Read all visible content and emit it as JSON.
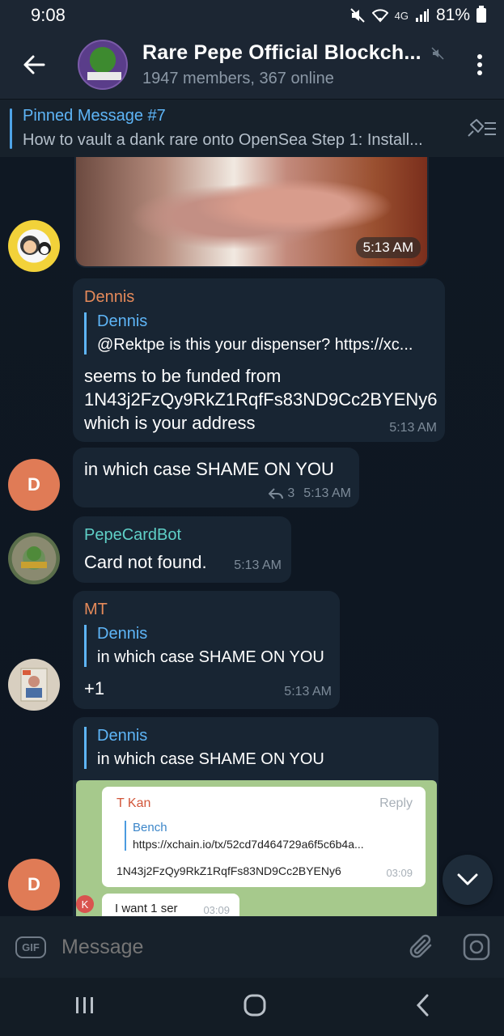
{
  "status_bar": {
    "time": "9:08",
    "network": "4G",
    "battery": "81%"
  },
  "header": {
    "title": "Rare Pepe Official Blockch...",
    "subtitle": "1947 members, 367 online"
  },
  "pinned": {
    "title": "Pinned Message #7",
    "text": "How to vault a dank rare onto OpenSea  Step 1: Install..."
  },
  "messages": [
    {
      "type": "image",
      "time": "5:13 AM"
    },
    {
      "sender": "Dennis",
      "sender_color": "#e58a5a",
      "reply_name": "Dennis",
      "reply_text": "@Rektpe is this your dispenser?  https://xc...",
      "text": "seems to be funded from 1N43j2FzQy9RkZ1RqfFs83ND9Cc2BYENy6 which is your address",
      "time": "5:13 AM"
    },
    {
      "text": "in which case SHAME ON YOU",
      "reply_count": "3",
      "time": "5:13 AM",
      "avatar_letter": "D"
    },
    {
      "sender": "PepeCardBot",
      "sender_color": "#5fd0c7",
      "text": "Card not found.",
      "time": "5:13 AM"
    },
    {
      "sender": "MT",
      "sender_color": "#e58a5a",
      "reply_name": "Dennis",
      "reply_text": "in which case SHAME ON YOU",
      "text": "+1",
      "time": "5:13 AM"
    },
    {
      "reply_name": "Dennis",
      "reply_text": "in which case SHAME ON YOU",
      "avatar_letter": "D",
      "screenshot": {
        "name": "T Kan",
        "reply_button": "Reply",
        "reply_name": "Bench",
        "reply_text": "https://xchain.io/tx/52cd7d464729a6f5c6b4a...",
        "line": "1N43j2FzQy9RkZ1RqfFs83ND9Cc2BYENy6",
        "time": "03:09",
        "second_text": "I want 1 ser",
        "second_time": "03:09",
        "badge": "K"
      }
    }
  ],
  "composer": {
    "gif_label": "GIF",
    "placeholder": "Message"
  },
  "colors": {
    "accent": "#5eb5f7",
    "bubble": "#182533",
    "background": "#0e1621",
    "avatar_d": "#e07b56"
  }
}
